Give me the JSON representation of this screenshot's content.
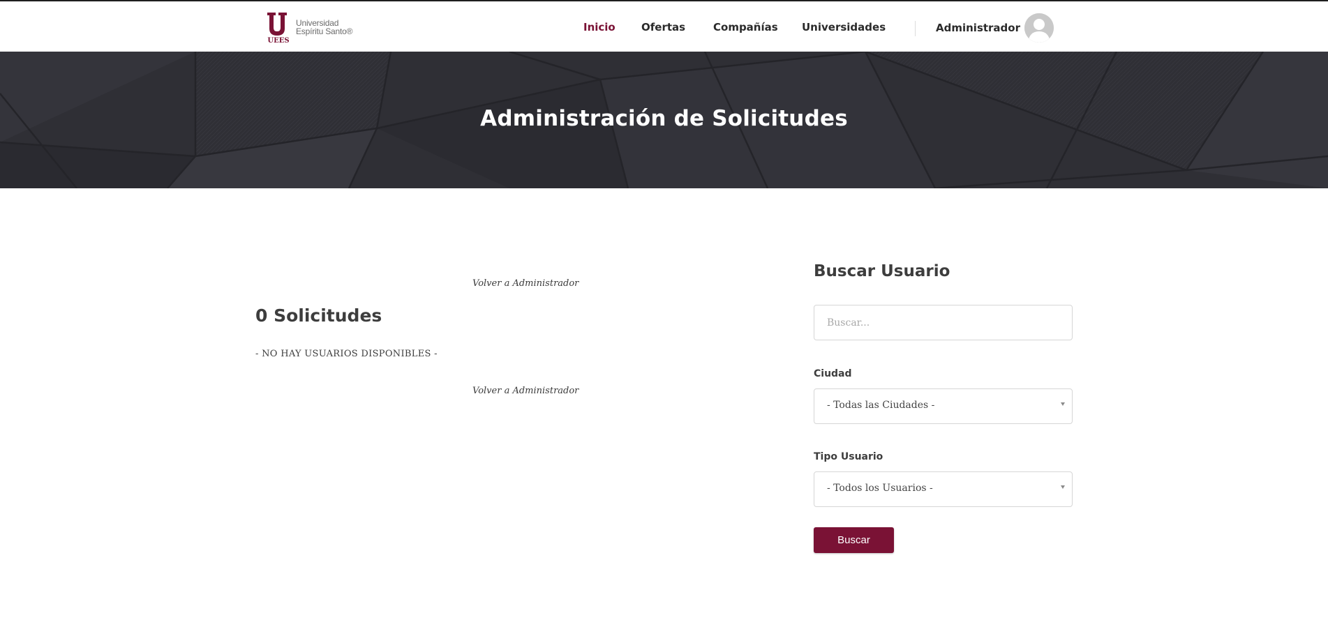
{
  "colors": {
    "brand": "#7a1235",
    "banner_bg": "#2f2f35",
    "heading": "#3d3d3d"
  },
  "logo": {
    "mark_text": "UEES",
    "line1": "Universidad",
    "line2": "Espíritu Santo®"
  },
  "nav": {
    "items": [
      {
        "label": "Inicio",
        "active": true
      },
      {
        "label": "Ofertas",
        "active": false
      },
      {
        "label": "Compañías",
        "active": false
      },
      {
        "label": "Universidades",
        "active": false
      }
    ],
    "user_name": "Administrador",
    "avatar_icon": "user-avatar-icon"
  },
  "banner": {
    "title": "Administración de Solicitudes"
  },
  "main": {
    "back_link_top": "Volver a Administrador",
    "count_heading": "0 Solicitudes",
    "empty_message": "- NO HAY USUARIOS DISPONIBLES -",
    "back_link_bottom": "Volver a Administrador"
  },
  "sidebar": {
    "title": "Buscar Usuario",
    "search": {
      "placeholder": "Buscar...",
      "value": ""
    },
    "city": {
      "label": "Ciudad",
      "selected": "- Todas las Ciudades -"
    },
    "user_type": {
      "label": "Tipo Usuario",
      "selected": "- Todos los Usuarios -"
    },
    "submit_label": "Buscar"
  }
}
